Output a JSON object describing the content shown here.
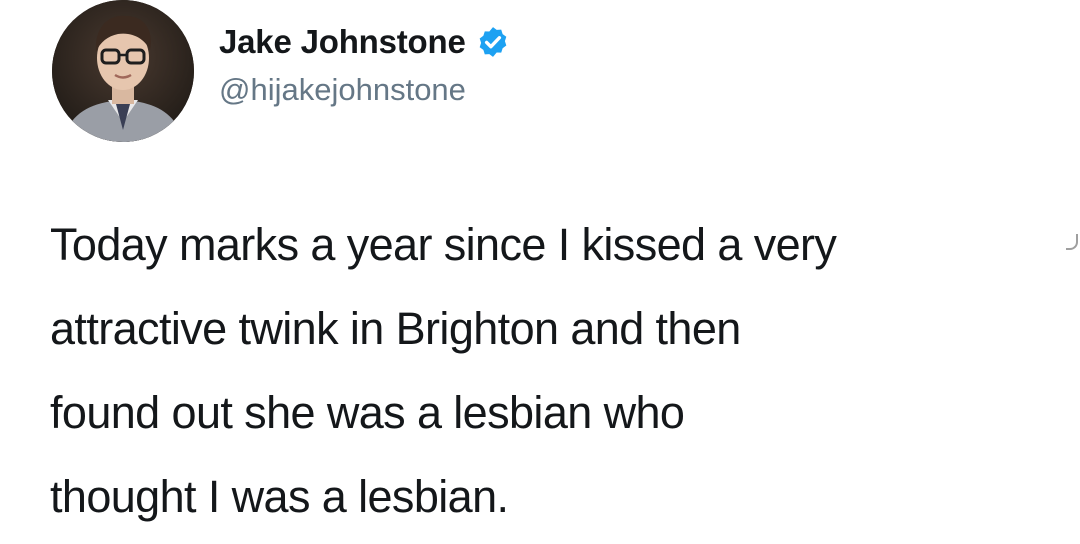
{
  "author": {
    "display_name": "Jake Johnstone",
    "handle": "@hijakejohnstone",
    "verified": true,
    "avatar_icon": "profile-photo",
    "verified_icon": "verified-badge-icon"
  },
  "tweet": {
    "lines": [
      "Today marks a year since I kissed a very",
      "attractive twink in Brighton and then",
      "found out she was a lesbian who",
      "thought I was a lesbian."
    ]
  },
  "colors": {
    "text": "#14171a",
    "handle": "#657786",
    "verified": "#1da1f2",
    "background": "#ffffff"
  }
}
